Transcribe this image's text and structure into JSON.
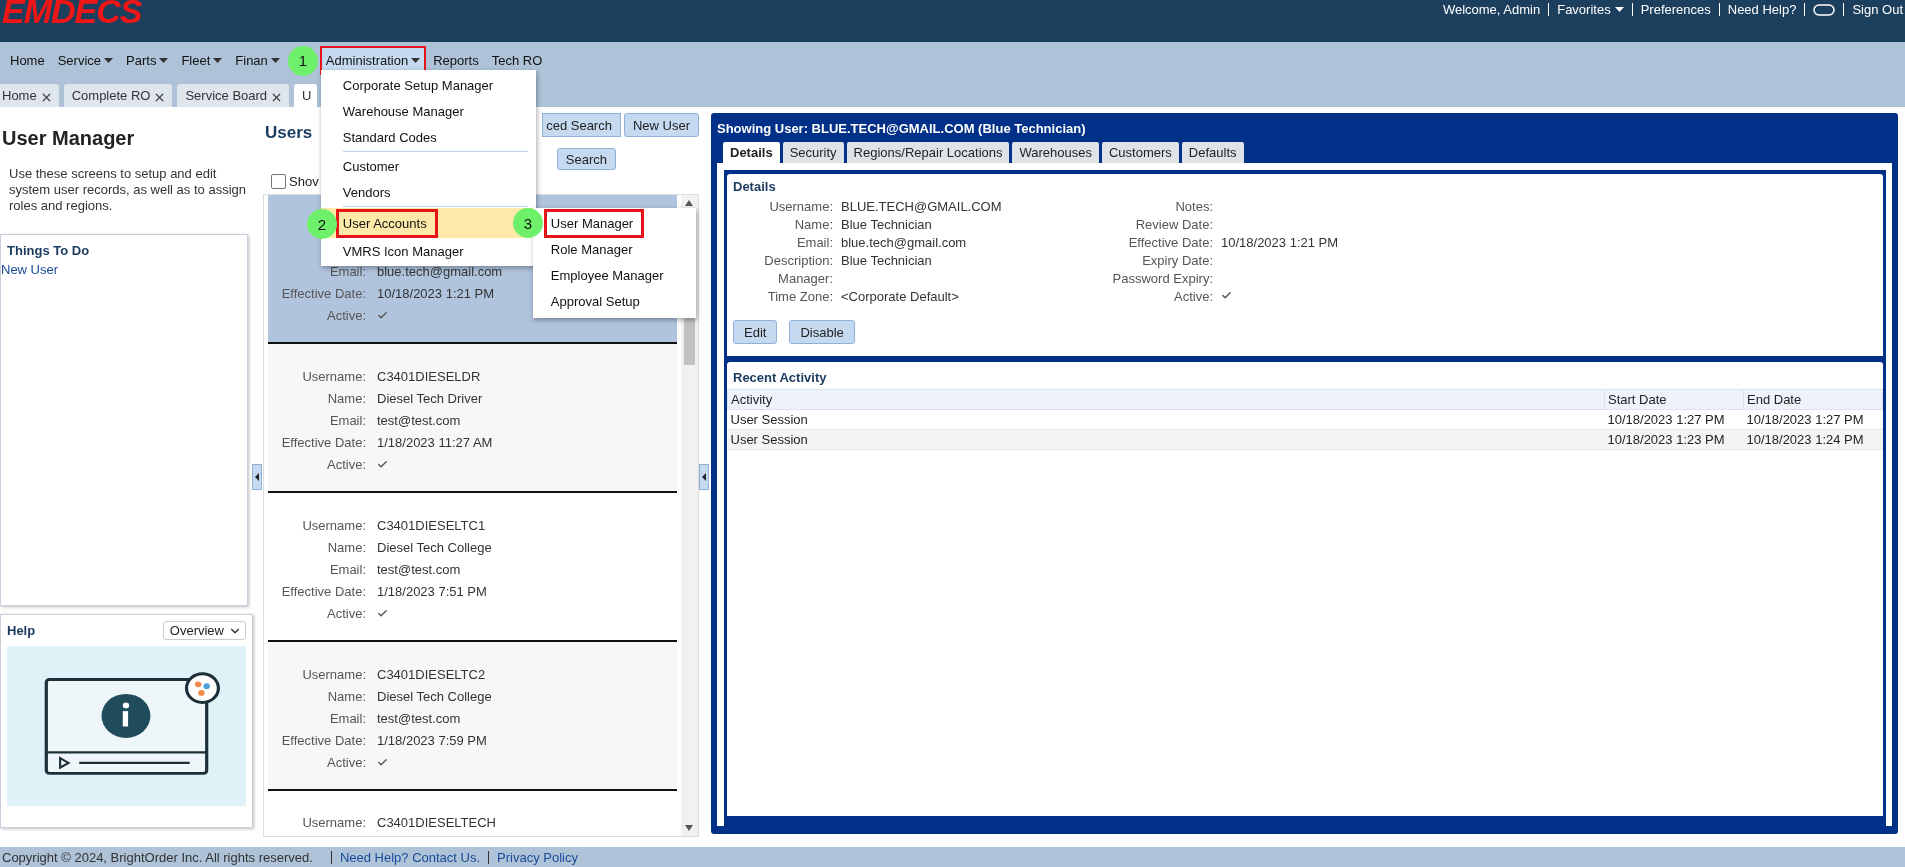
{
  "header": {
    "logo": "EMDECS",
    "links": [
      {
        "kind": "text",
        "label": "Welcome, Admin"
      },
      {
        "kind": "dropdown",
        "label": "Favorites"
      },
      {
        "kind": "text",
        "label": "Preferences"
      },
      {
        "kind": "text",
        "label": "Need Help?"
      },
      {
        "kind": "icon"
      },
      {
        "kind": "text",
        "label": "Sign Out"
      }
    ]
  },
  "nav": [
    {
      "label": "Home",
      "dropdown": false,
      "selected": false,
      "highlighted": false
    },
    {
      "label": "Service",
      "dropdown": true,
      "selected": false,
      "highlighted": false
    },
    {
      "label": "Parts",
      "dropdown": true,
      "selected": false,
      "highlighted": false
    },
    {
      "label": "Fleet",
      "dropdown": true,
      "selected": false,
      "highlighted": false
    },
    {
      "label": "Finan",
      "dropdown": true,
      "selected": false,
      "highlighted": false
    },
    {
      "label": "Administration",
      "dropdown": true,
      "selected": true,
      "highlighted": true,
      "callout": "1",
      "menu": [
        {
          "label": "Corporate Setup Manager",
          "selected": false,
          "highlighted": false
        },
        {
          "label": "Warehouse Manager",
          "selected": false,
          "highlighted": false
        },
        {
          "label": "Standard Codes",
          "selected": false,
          "highlighted": false
        },
        {
          "label": "Customer",
          "selected": false,
          "highlighted": false,
          "divider_before": true
        },
        {
          "label": "Vendors",
          "selected": false,
          "highlighted": false
        },
        {
          "label": "User Accounts",
          "selected": true,
          "highlighted": true,
          "callout": "2",
          "divider_before": true,
          "submenu": [
            {
              "label": "User Manager",
              "selected": false,
              "highlighted": true,
              "callout": "3"
            },
            {
              "label": "Role Manager",
              "selected": false,
              "highlighted": false
            },
            {
              "label": "Employee Manager",
              "selected": false,
              "highlighted": false
            },
            {
              "label": "Approval Setup",
              "selected": false,
              "highlighted": false
            }
          ]
        },
        {
          "label": "VMRS Icon Manager",
          "selected": false,
          "highlighted": false
        }
      ]
    },
    {
      "label": "Reports",
      "dropdown": false,
      "selected": false,
      "highlighted": false
    },
    {
      "label": "Tech RO",
      "dropdown": false,
      "selected": false,
      "highlighted": false
    }
  ],
  "tabs": [
    {
      "label": "Home",
      "closable": true,
      "selected": false
    },
    {
      "label": "Complete RO",
      "closable": true,
      "selected": false
    },
    {
      "label": "Service Board",
      "closable": true,
      "selected": false
    },
    {
      "label": "U",
      "closable": false,
      "selected": true
    }
  ],
  "left": {
    "title": "User Manager",
    "description": "Use these screens to setup and edit system user records, as well as to assign roles and regions.",
    "things_to_do": {
      "title": "Things To Do",
      "items": [
        "New User"
      ]
    },
    "help": {
      "title": "Help",
      "select": "Overview"
    }
  },
  "users": {
    "title": "Users",
    "buttons": [
      "ced Search",
      "New User"
    ],
    "search_button": "Search",
    "show_checkbox": {
      "label": "Shov",
      "checked": false
    },
    "cards": [
      {
        "selected": true,
        "fields": [
          {
            "label": "Email:",
            "value": "blue.tech@gmail.com"
          },
          {
            "label": "Effective Date:",
            "value": "10/18/2023 1:21 PM"
          },
          {
            "label": "Active:",
            "kind": "check",
            "checked": true
          }
        ]
      },
      {
        "selected": false,
        "fields": [
          {
            "label": "Username:",
            "value": "C3401DIESELDR"
          },
          {
            "label": "Name:",
            "value": "Diesel Tech Driver"
          },
          {
            "label": "Email:",
            "value": "test@test.com"
          },
          {
            "label": "Effective Date:",
            "value": "1/18/2023 11:27 AM"
          },
          {
            "label": "Active:",
            "kind": "check",
            "checked": true
          }
        ]
      },
      {
        "selected": false,
        "fields": [
          {
            "label": "Username:",
            "value": "C3401DIESELTC1"
          },
          {
            "label": "Name:",
            "value": "Diesel Tech College"
          },
          {
            "label": "Email:",
            "value": "test@test.com"
          },
          {
            "label": "Effective Date:",
            "value": "1/18/2023 7:51 PM"
          },
          {
            "label": "Active:",
            "kind": "check",
            "checked": true
          }
        ]
      },
      {
        "selected": false,
        "fields": [
          {
            "label": "Username:",
            "value": "C3401DIESELTC2"
          },
          {
            "label": "Name:",
            "value": "Diesel Tech College"
          },
          {
            "label": "Email:",
            "value": "test@test.com"
          },
          {
            "label": "Effective Date:",
            "value": "1/18/2023 7:59 PM"
          },
          {
            "label": "Active:",
            "kind": "check",
            "checked": true
          }
        ]
      },
      {
        "selected": false,
        "fields": [
          {
            "label": "Username:",
            "value": "C3401DIESELTECH"
          }
        ]
      }
    ]
  },
  "detail": {
    "title": "Showing User: BLUE.TECH@GMAIL.COM (Blue Technician)",
    "tabs": [
      {
        "label": "Details",
        "selected": true
      },
      {
        "label": "Security",
        "selected": false
      },
      {
        "label": "Regions/Repair Locations",
        "selected": false
      },
      {
        "label": "Warehouses",
        "selected": false
      },
      {
        "label": "Customers",
        "selected": false
      },
      {
        "label": "Defaults",
        "selected": false
      }
    ],
    "details": {
      "title": "Details",
      "left_fields": [
        {
          "label": "Username:",
          "value": "BLUE.TECH@GMAIL.COM"
        },
        {
          "label": "Name:",
          "value": "Blue Technician"
        },
        {
          "label": "Email:",
          "value": "blue.tech@gmail.com"
        },
        {
          "label": "Description:",
          "value": "Blue Technician"
        },
        {
          "label": "Manager:"
        },
        {
          "label": "Time Zone:",
          "value": "<Corporate Default>"
        }
      ],
      "right_fields": [
        {
          "label": "Notes:"
        },
        {
          "label": "Review Date:"
        },
        {
          "label": "Effective Date:",
          "value": "10/18/2023 1:21 PM"
        },
        {
          "label": "Expiry Date:"
        },
        {
          "label": "Password Expiry:"
        },
        {
          "label": "Active:",
          "kind": "check",
          "checked": true
        }
      ],
      "buttons": [
        "Edit",
        "Disable"
      ]
    },
    "activity": {
      "title": "Recent Activity",
      "columns": [
        "Activity",
        "Start Date",
        "End Date"
      ],
      "rows": [
        [
          "User Session",
          "10/18/2023 1:27 PM",
          "10/18/2023 1:27 PM"
        ],
        [
          "User Session",
          "10/18/2023 1:23 PM",
          "10/18/2023 1:24 PM"
        ]
      ]
    }
  },
  "footer": {
    "copyright": "Copyright © 2024, BrightOrder Inc. All rights reserved.",
    "links": [
      "Need Help? Contact Us.",
      "Privacy Policy"
    ]
  }
}
